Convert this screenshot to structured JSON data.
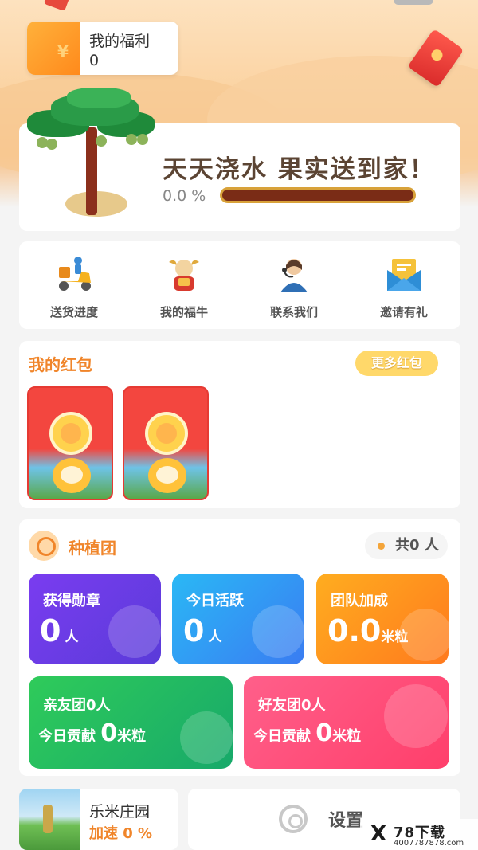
{
  "welfare": {
    "title": "我的福利",
    "value": "0",
    "icon_glyph": "¥"
  },
  "hero": {
    "slogan": "天天浇水 果实送到家！",
    "progress_text": "0.0 %",
    "progress": 0.0
  },
  "quick_actions": [
    {
      "label": "送货进度",
      "icon": "delivery-scooter-icon"
    },
    {
      "label": "我的福牛",
      "icon": "lucky-ox-icon"
    },
    {
      "label": "联系我们",
      "icon": "customer-service-icon"
    },
    {
      "label": "邀请有礼",
      "icon": "invite-envelope-icon"
    }
  ],
  "red_packets": {
    "title": "我的红包",
    "more_label": "更多红包",
    "items": [
      {
        "icon": "red-packet-icon"
      },
      {
        "icon": "red-packet-ox-icon"
      }
    ]
  },
  "team": {
    "title": "种植团",
    "count_prefix": "共",
    "count": "0",
    "count_unit": "人",
    "stats": [
      {
        "title": "获得勋章",
        "value": "0",
        "unit": "人"
      },
      {
        "title": "今日活跃",
        "value": "0",
        "unit": "人"
      },
      {
        "title": "团队加成",
        "value": "0.0",
        "unit": "米粒"
      }
    ],
    "groups": [
      {
        "title": "亲友团0人",
        "contrib_label": "今日贡献",
        "value": "0",
        "unit": "米粒"
      },
      {
        "title": "好友团0人",
        "contrib_label": "今日贡献",
        "value": "0",
        "unit": "米粒"
      }
    ]
  },
  "farm": {
    "name": "乐米庄园",
    "speed": "加速 0 %"
  },
  "settings": {
    "label": "设置"
  },
  "watermark": {
    "logo": "X",
    "name": "78下载",
    "site": "4007787878.com"
  },
  "colors": {
    "accent": "#f0852a",
    "progress_bar": "#7a2c16",
    "background": "#f4f4f4"
  }
}
